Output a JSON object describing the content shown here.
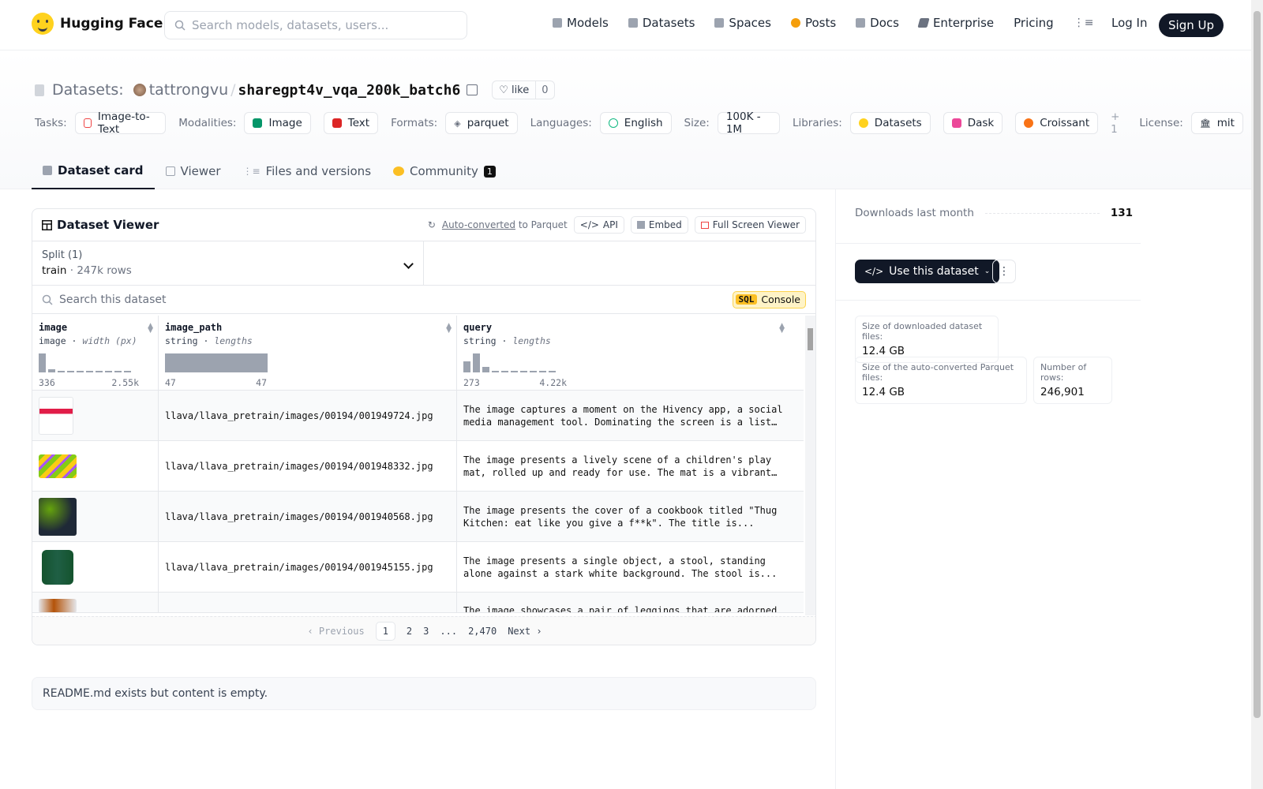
{
  "header": {
    "brand": "Hugging Face",
    "search_placeholder": "Search models, datasets, users...",
    "nav": [
      {
        "label": "Models",
        "icon": "cube-icon",
        "color": "#9ca3af"
      },
      {
        "label": "Datasets",
        "icon": "database-icon",
        "color": "#9ca3af"
      },
      {
        "label": "Spaces",
        "icon": "spaces-icon",
        "color": "#9ca3af"
      },
      {
        "label": "Posts",
        "icon": "posts-icon",
        "color": "#f59e0b"
      },
      {
        "label": "Docs",
        "icon": "docs-icon",
        "color": "#9ca3af"
      },
      {
        "label": "Enterprise",
        "icon": "enterprise-icon",
        "color": "#6b7280"
      },
      {
        "label": "Pricing"
      }
    ],
    "login": "Log In",
    "signup": "Sign Up"
  },
  "dataset": {
    "section": "Datasets:",
    "owner": "tattrongvu",
    "separator": "/",
    "name": "sharegpt4v_vqa_200k_batch6",
    "like_label": "like",
    "like_count": "0"
  },
  "tags": {
    "tasks_label": "Tasks:",
    "task": "Image-to-Text",
    "modalities_label": "Modalities:",
    "modalities": [
      "Image",
      "Text"
    ],
    "formats_label": "Formats:",
    "format": "parquet",
    "languages_label": "Languages:",
    "language": "English",
    "size_label": "Size:",
    "size": "100K - 1M",
    "libraries_label": "Libraries:",
    "libraries": [
      "Datasets",
      "Dask",
      "Croissant"
    ],
    "libraries_more": "+ 1",
    "license_label": "License:",
    "license": "mit"
  },
  "tabs": [
    {
      "label": "Dataset card",
      "active": true
    },
    {
      "label": "Viewer"
    },
    {
      "label": "Files and versions"
    },
    {
      "label": "Community",
      "badge": "1"
    }
  ],
  "viewer": {
    "title": "Dataset Viewer",
    "auto_converted": "Auto-converted",
    "to_parquet": "to Parquet",
    "api": "API",
    "embed": "Embed",
    "fullscreen": "Full Screen Viewer",
    "split_label": "Split (1)",
    "split_name": "train",
    "split_dot": "·",
    "split_rows": "247k rows",
    "search_placeholder": "Search this dataset",
    "sql_tag": "SQL",
    "console": "Console",
    "columns": [
      {
        "name": "image",
        "type": "image",
        "stat": "width (px)",
        "min": "336",
        "max": "2.55k",
        "hist": [
          1.0,
          0.15,
          0.05,
          0.05,
          0.05,
          0.05,
          0.05,
          0.05,
          0.05,
          0.05
        ]
      },
      {
        "name": "image_path",
        "type": "string",
        "stat": "lengths",
        "min": "47",
        "max": "47",
        "hist": [
          1.0
        ]
      },
      {
        "name": "query",
        "type": "string",
        "stat": "lengths",
        "min": "273",
        "max": "4.22k",
        "hist": [
          0.6,
          1.0,
          0.3,
          0.05,
          0.05,
          0.05,
          0.05,
          0.05,
          0.05,
          0.05
        ]
      }
    ],
    "rows": [
      {
        "path": "llava/llava_pretrain/images/00194/001949724.jpg",
        "query": "The image captures a moment on the Hivency app, a social media management tool. Dominating the screen is a list of..."
      },
      {
        "path": "llava/llava_pretrain/images/00194/001948332.jpg",
        "query": "The image presents a lively scene of a children's play mat, rolled up and ready for use. The mat is a vibrant mi..."
      },
      {
        "path": "llava/llava_pretrain/images/00194/001940568.jpg",
        "query": "The image presents the cover of a cookbook titled \"Thug Kitchen: eat like you give a f**k\". The title is..."
      },
      {
        "path": "llava/llava_pretrain/images/00194/001945155.jpg",
        "query": "The image presents a single object, a stool, standing alone against a stark white background. The stool is..."
      },
      {
        "path": "",
        "query": "The image showcases a pair of leggings that are adorned"
      }
    ],
    "pagination": {
      "prev": "Previous",
      "pages": [
        "1",
        "2",
        "3",
        "...",
        "2,470"
      ],
      "next": "Next"
    }
  },
  "readme": "README.md exists but content is empty.",
  "sidebar": {
    "downloads_label": "Downloads last month",
    "downloads": "131",
    "use_button": "Use this dataset",
    "size_download_label": "Size of downloaded dataset files:",
    "size_download": "12.4 GB",
    "size_parquet_label": "Size of the auto-converted Parquet files:",
    "size_parquet": "12.4 GB",
    "rows_label": "Number of rows:",
    "rows": "246,901"
  }
}
